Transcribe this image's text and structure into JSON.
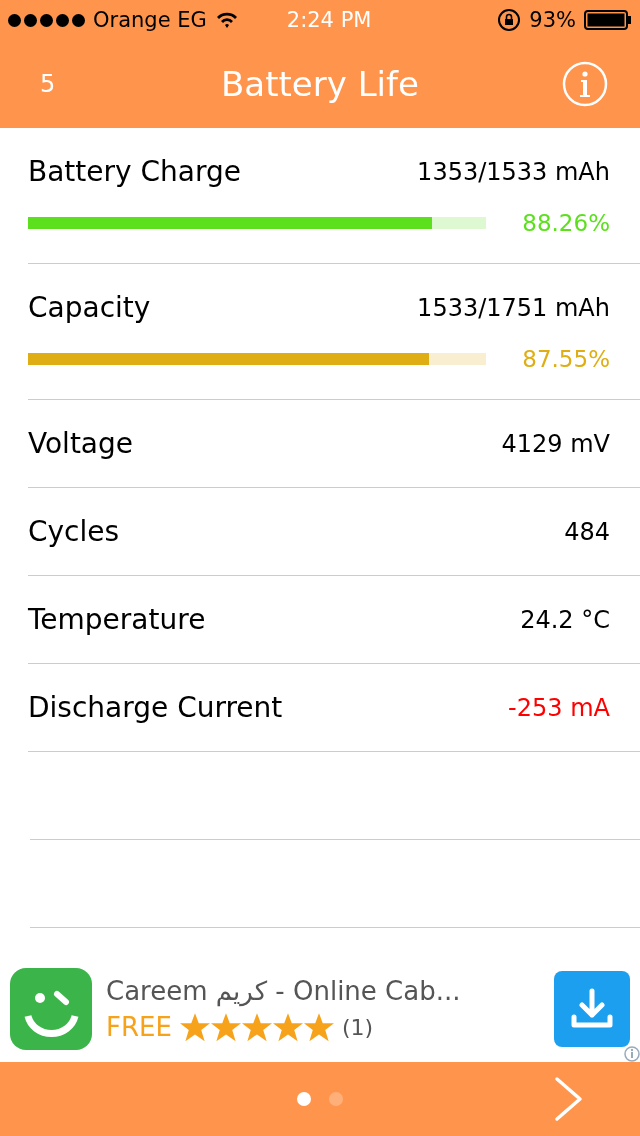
{
  "status_bar": {
    "carrier": "Orange EG",
    "time": "2:24 PM",
    "battery_percent": "93%"
  },
  "header": {
    "badge": "5",
    "title": "Battery Life"
  },
  "rows": [
    {
      "kind": "bar",
      "label": "Battery Charge",
      "value": "1353/1533 mAh",
      "level": 0.8826,
      "reading": "88.26%",
      "color": "#5ce01e"
    },
    {
      "kind": "bar",
      "label": "Capacity",
      "value": "1533/1751 mAh",
      "level": 0.8755,
      "reading": "87.55%",
      "color": "#dfae14"
    },
    {
      "kind": "value",
      "label": "Voltage",
      "value": "4129 mV",
      "color": "#000000"
    },
    {
      "kind": "value",
      "label": "Cycles",
      "value": "484",
      "color": "#000000"
    },
    {
      "kind": "value",
      "label": "Temperature",
      "value": "24.2 °C",
      "color": "#000000"
    },
    {
      "kind": "value",
      "label": "Discharge Current",
      "value": "-253 mA",
      "color": "#ff0000"
    }
  ],
  "ad": {
    "title": "Careem كريم - Online Cab...",
    "price": "FREE",
    "stars": 5,
    "count": "(1)"
  },
  "pages": [
    {
      "selected": true
    },
    {
      "selected": false
    }
  ]
}
